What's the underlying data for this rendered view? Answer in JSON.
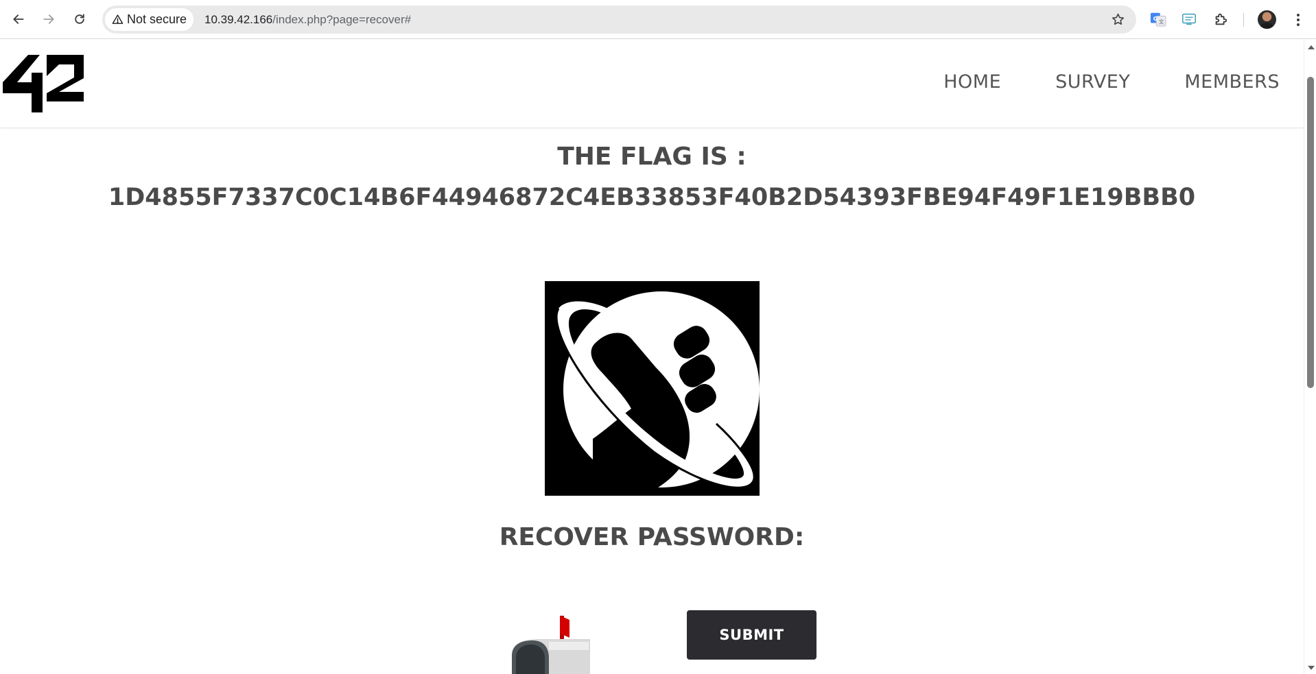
{
  "browser": {
    "security_label": "Not secure",
    "url_host": "10.39.42.166",
    "url_path": "/index.php?page=recover#"
  },
  "header": {
    "nav": [
      {
        "label": "HOME"
      },
      {
        "label": "SURVEY"
      },
      {
        "label": "MEMBERS"
      }
    ]
  },
  "main": {
    "flag_title": "THE FLAG IS :",
    "flag_value": "1D4855F7337C0C14B6F44946872C4EB33853F40B2D54393FBE94F49F1E19BBB0",
    "recover_title": "RECOVER PASSWORD:",
    "submit_label": "SUBMIT"
  },
  "icons": {
    "back": "back-arrow-icon",
    "forward": "forward-arrow-icon",
    "reload": "reload-icon",
    "warning": "warning-triangle-icon",
    "bookmark": "star-icon",
    "translate": "google-translate-icon",
    "extension_1": "screen-reader-extension-icon",
    "extensions": "puzzle-piece-icon",
    "profile": "profile-avatar",
    "menu": "kebab-menu-icon"
  },
  "colors": {
    "heading_text": "#4a4a4a",
    "nav_text": "#555555",
    "button_bg": "#2c2c30",
    "omnibox_bg": "#e9e9e9"
  }
}
